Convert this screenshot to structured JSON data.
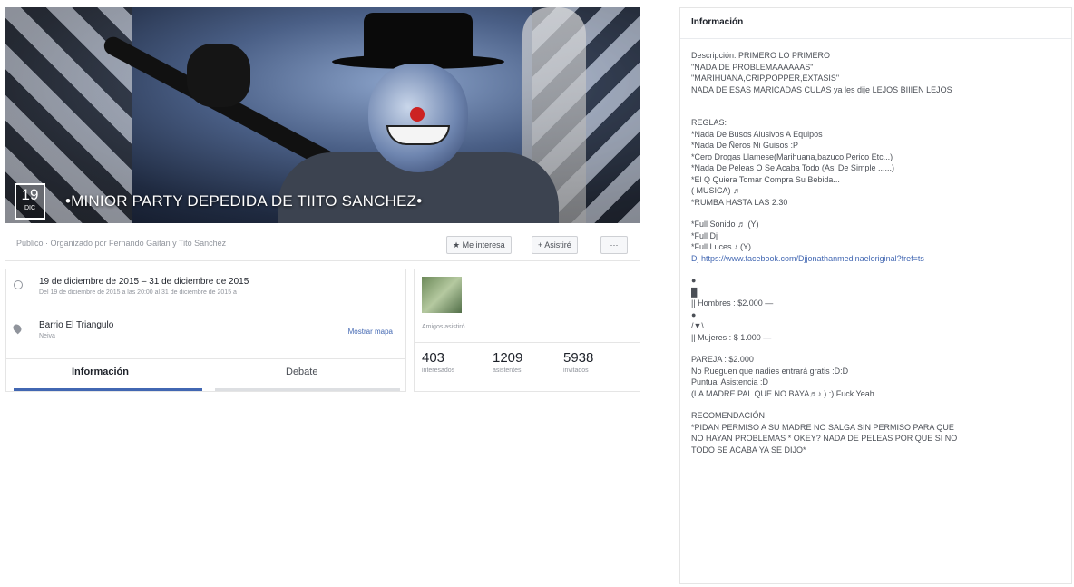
{
  "cover": {
    "date_day": "19",
    "date_month": "DIC",
    "title": "•MINIOR PARTY DEPEDIDA DE TIITO SANCHEZ•"
  },
  "meta": {
    "privacy": "Público · Organizado por Fernando Gaitan y Tito Sanchez",
    "interested_label": "★ Me interesa",
    "attend_label": "+ Asistiré",
    "more_label": "···"
  },
  "details": {
    "date_main": "19 de diciembre de 2015 – 31 de diciembre de 2015",
    "date_sub": "Del 19 de diciembre de 2015 a las 20:00 al 31 de diciembre de 2015 a",
    "place_main": "Barrio El Triangulo",
    "place_sub": "Neiva",
    "map_label": "Mostrar mapa"
  },
  "tabs": {
    "info": "Información",
    "debate": "Debate"
  },
  "attendance": {
    "thumb_label": "Amigos asistiró",
    "stats": [
      {
        "value": "403",
        "label": "interesados"
      },
      {
        "value": "1209",
        "label": "asistentes"
      },
      {
        "value": "5938",
        "label": "invitados"
      }
    ]
  },
  "info": {
    "heading": "Información",
    "lines": [
      "Descripción: PRIMERO LO PRIMERO",
      "\"NADA DE PROBLEMAAAAAAS\"",
      "\"MARIHUANA,CRIP,POPPER,EXTASIS\"",
      "NADA DE ESAS MARICADAS CULAS ya les dije LEJOS BIIIEN LEJOS",
      "",
      "",
      "REGLAS:",
      "*Nada De Busos Alusivos A Equipos",
      "*Nada De Ñeros Ni Guisos :P",
      "*Cero Drogas Llamese(Marihuana,bazuco,Perico Etc...)",
      "*Nada De Peleas O Se Acaba Todo (Asi De Simple ......)",
      "*El Q Quiera Tomar Compra Su Bebida...",
      "( MUSICA) ♬",
      "*RUMBA HASTA LAS 2:30",
      "",
      "*Full Sonido ♬ (Y)",
      "*Full Dj",
      "*Full Luces ♪ (Y)",
      "Dj https://www.facebook.com/Djjonathanmedinaeloriginal?fref=ts",
      "",
      "●",
      "█",
      "|| Hombres : $2.000 —",
      "●",
      "/▼\\",
      "|| Mujeres : $ 1.000 —",
      "",
      "PAREJA : $2.000",
      "No Rueguen que nadies entrará gratis :D:D",
      "Puntual Asistencia :D",
      "(LA MADRE PAL QUE NO BAYA♬♪ ) :) Fuck Yeah",
      "",
      "RECOMENDACIÓN",
      "*PIDAN PERMISO A SU MADRE NO SALGA SIN PERMISO PARA QUE",
      "NO HAYAN PROBLEMAS * OKEY? NADA DE PELEAS POR QUE SI NO",
      "TODO SE ACABA YA SE DIJO*"
    ]
  }
}
